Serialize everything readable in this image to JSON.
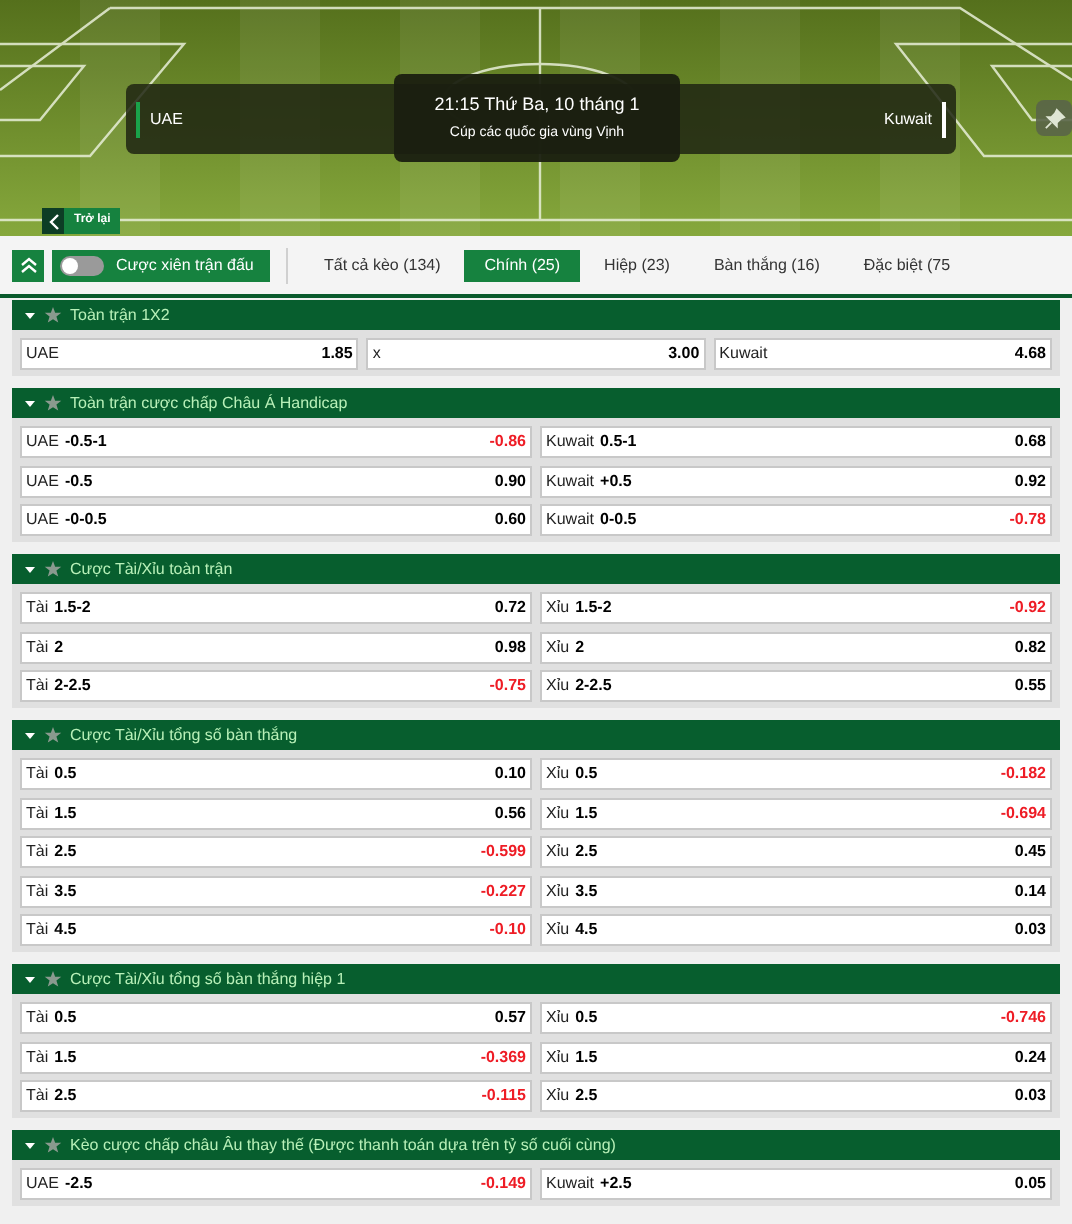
{
  "match": {
    "home": "UAE",
    "away": "Kuwait",
    "time": "21:15 Thứ Ba, 10 tháng 1",
    "competition": "Cúp các quốc gia vùng Vịnh"
  },
  "back_button": "Trở lại",
  "toolbar": {
    "toggle": {
      "label": "Cược xiên trận đấu",
      "on": false
    },
    "tabs": [
      {
        "label": "Tất cả kèo (134)",
        "selected": false
      },
      {
        "label": "Chính (25)",
        "selected": true
      },
      {
        "label": "Hiệp (23)",
        "selected": false
      },
      {
        "label": "Bàn thắng (16)",
        "selected": false
      },
      {
        "label": "Đặc biệt (75",
        "selected": false
      }
    ]
  },
  "markets": [
    {
      "title": "Toàn trận 1X2",
      "expanded": true,
      "favorite": false,
      "rows": [
        [
          {
            "label": "UAE",
            "odds": "1.85",
            "negative": false
          },
          {
            "label": "x",
            "odds": "3.00",
            "negative": false
          },
          {
            "label": "Kuwait",
            "odds": "4.68",
            "negative": false
          }
        ]
      ]
    },
    {
      "title": "Toàn trận cược chấp Châu Á Handicap",
      "expanded": true,
      "favorite": false,
      "rows": [
        [
          {
            "label": "UAE",
            "line": "-0.5-1",
            "odds": "-0.86",
            "negative": true
          },
          {
            "label": "Kuwait",
            "line": "0.5-1",
            "odds": "0.68",
            "negative": false
          }
        ],
        [
          {
            "label": "UAE",
            "line": "-0.5",
            "odds": "0.90",
            "negative": false
          },
          {
            "label": "Kuwait",
            "line": "+0.5",
            "odds": "0.92",
            "negative": false
          }
        ],
        [
          {
            "label": "UAE",
            "line": "-0-0.5",
            "odds": "0.60",
            "negative": false
          },
          {
            "label": "Kuwait",
            "line": "0-0.5",
            "odds": "-0.78",
            "negative": true
          }
        ]
      ]
    },
    {
      "title": "Cược Tài/Xỉu toàn trận",
      "expanded": true,
      "favorite": false,
      "rows": [
        [
          {
            "label": "Tài",
            "line": "1.5-2",
            "odds": "0.72",
            "negative": false
          },
          {
            "label": "Xỉu",
            "line": "1.5-2",
            "odds": "-0.92",
            "negative": true
          }
        ],
        [
          {
            "label": "Tài",
            "line": "2",
            "odds": "0.98",
            "negative": false
          },
          {
            "label": "Xỉu",
            "line": "2",
            "odds": "0.82",
            "negative": false
          }
        ],
        [
          {
            "label": "Tài",
            "line": "2-2.5",
            "odds": "-0.75",
            "negative": true
          },
          {
            "label": "Xỉu",
            "line": "2-2.5",
            "odds": "0.55",
            "negative": false
          }
        ]
      ]
    },
    {
      "title": "Cược Tài/Xỉu tổng số bàn thắng",
      "expanded": true,
      "favorite": false,
      "rows": [
        [
          {
            "label": "Tài",
            "line": "0.5",
            "odds": "0.10",
            "negative": false
          },
          {
            "label": "Xỉu",
            "line": "0.5",
            "odds": "-0.182",
            "negative": true
          }
        ],
        [
          {
            "label": "Tài",
            "line": "1.5",
            "odds": "0.56",
            "negative": false
          },
          {
            "label": "Xỉu",
            "line": "1.5",
            "odds": "-0.694",
            "negative": true
          }
        ],
        [
          {
            "label": "Tài",
            "line": "2.5",
            "odds": "-0.599",
            "negative": true
          },
          {
            "label": "Xỉu",
            "line": "2.5",
            "odds": "0.45",
            "negative": false
          }
        ],
        [
          {
            "label": "Tài",
            "line": "3.5",
            "odds": "-0.227",
            "negative": true
          },
          {
            "label": "Xỉu",
            "line": "3.5",
            "odds": "0.14",
            "negative": false
          }
        ],
        [
          {
            "label": "Tài",
            "line": "4.5",
            "odds": "-0.10",
            "negative": true
          },
          {
            "label": "Xỉu",
            "line": "4.5",
            "odds": "0.03",
            "negative": false
          }
        ]
      ]
    },
    {
      "title": "Cược Tài/Xỉu tổng số bàn thắng hiệp 1",
      "expanded": true,
      "favorite": false,
      "rows": [
        [
          {
            "label": "Tài",
            "line": "0.5",
            "odds": "0.57",
            "negative": false
          },
          {
            "label": "Xỉu",
            "line": "0.5",
            "odds": "-0.746",
            "negative": true
          }
        ],
        [
          {
            "label": "Tài",
            "line": "1.5",
            "odds": "-0.369",
            "negative": true
          },
          {
            "label": "Xỉu",
            "line": "1.5",
            "odds": "0.24",
            "negative": false
          }
        ],
        [
          {
            "label": "Tài",
            "line": "2.5",
            "odds": "-0.115",
            "negative": true
          },
          {
            "label": "Xỉu",
            "line": "2.5",
            "odds": "0.03",
            "negative": false
          }
        ]
      ]
    },
    {
      "title": "Kèo cược chấp châu Âu thay thế (Được thanh toán dựa trên tỷ số cuối cùng)",
      "expanded": true,
      "favorite": false,
      "rows": [
        [
          {
            "label": "UAE",
            "line": "-2.5",
            "odds": "-0.149",
            "negative": true
          },
          {
            "label": "Kuwait",
            "line": "+2.5",
            "odds": "0.05",
            "negative": false
          }
        ]
      ]
    }
  ]
}
